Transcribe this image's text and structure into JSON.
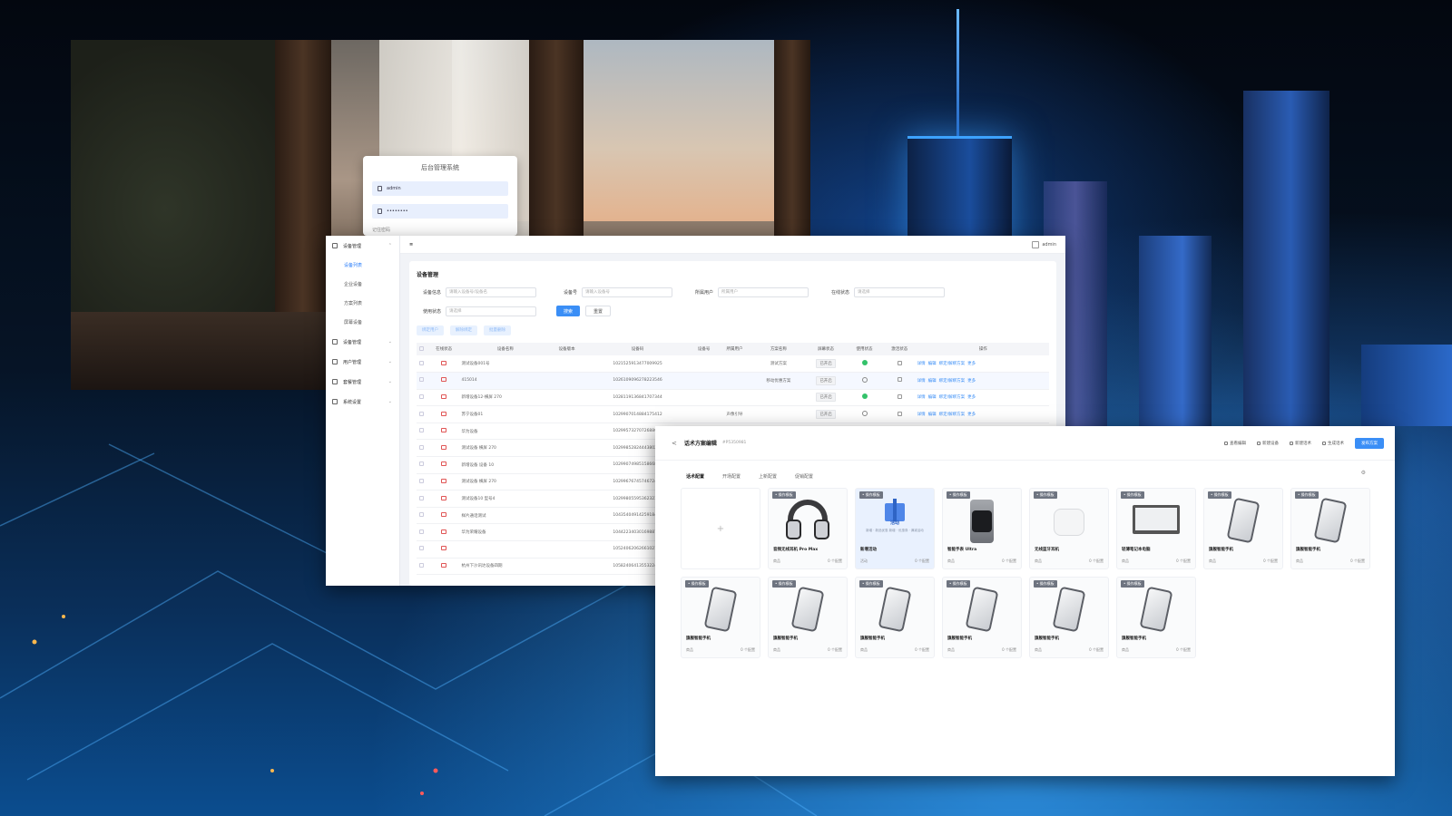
{
  "login": {
    "title": "后台管理系统",
    "username": "admin",
    "password": "••••••••",
    "extra": "记住密码"
  },
  "admin": {
    "sidebar": {
      "groups": [
        {
          "label": "设备管理",
          "items": [
            "设备列表",
            "企业设备",
            "方案列表",
            "屏幕设备"
          ]
        },
        {
          "label": "设备管理"
        },
        {
          "label": "用户管理"
        },
        {
          "label": "套餐管理"
        },
        {
          "label": "系统设置"
        }
      ]
    },
    "topbar": {
      "user": "admin"
    },
    "page_title": "设备管理",
    "filters": [
      {
        "label": "设备信息",
        "placeholder": "请输入设备号/设备名"
      },
      {
        "label": "设备号",
        "placeholder": "请输入设备号"
      },
      {
        "label": "所属用户",
        "placeholder": "所属用户"
      },
      {
        "label": "在线状态",
        "placeholder": "请选择"
      },
      {
        "label": "使用状态",
        "placeholder": "请选择"
      }
    ],
    "buttons": {
      "search": "搜索",
      "reset": "重置",
      "bind": "绑定用户",
      "unbind": "解除绑定",
      "batch": "批量删除"
    },
    "columns": [
      "在线状态",
      "设备名称",
      "设备版本",
      "设备码",
      "设备号",
      "所属用户",
      "方案名称",
      "屏幕状态",
      "使用状态",
      "激活状态",
      "操作"
    ],
    "rows": [
      {
        "name": "测试设备001号",
        "code": "1021525913477009925",
        "user": "",
        "scheme": "测试方案",
        "screen": "已开启",
        "status": "ok"
      },
      {
        "name": "415014",
        "code": "1026109096278223546",
        "user": "",
        "scheme": "移动优惠方案",
        "screen": "已开启",
        "status": "ring"
      },
      {
        "name": "新增设备12-横屏 270",
        "code": "1028119136841707344",
        "user": "",
        "scheme": "",
        "screen": "已开启",
        "status": "ok"
      },
      {
        "name": "苏宁设备01",
        "code": "1029907014884175412",
        "user": "声像引导",
        "scheme": "",
        "screen": "已开启",
        "status": "ring"
      },
      {
        "name": "华为设备",
        "code": "1029957327072688080",
        "user": "",
        "scheme": "",
        "screen": "",
        "status": ""
      },
      {
        "name": "测试设备 横屏 270",
        "code": "1029985282444380288",
        "user": "",
        "scheme": "",
        "screen": "",
        "status": ""
      },
      {
        "name": "新增设备 设备 10",
        "code": "1029907498515866846",
        "user": "",
        "scheme": "",
        "screen": "",
        "status": ""
      },
      {
        "name": "测试设备 横屏 270",
        "code": "1029967674574672416",
        "user": "",
        "scheme": "",
        "screen": "",
        "status": ""
      },
      {
        "name": "测试设备10 型号4",
        "code": "1029980559536232364",
        "user": "",
        "scheme": "",
        "screen": "",
        "status": ""
      },
      {
        "name": "样片通话测试",
        "code": "1043540491425918476",
        "user": "",
        "scheme": "",
        "screen": "",
        "status": ""
      },
      {
        "name": "华为荣耀设备",
        "code": "1044223403016988728",
        "user": "",
        "scheme": "",
        "screen": "",
        "status": ""
      },
      {
        "name": "",
        "code": "1052406206266102144",
        "user": "",
        "scheme": "",
        "screen": "",
        "status": ""
      },
      {
        "name": "杭州下沙讯达设备四期",
        "code": "1058240641355322498",
        "user": "",
        "scheme": "",
        "screen": "",
        "status": ""
      }
    ],
    "row_ops": [
      "详情",
      "编辑",
      "绑定/解绑方案",
      "更多"
    ]
  },
  "editor": {
    "back": "<",
    "title": "话术方案编辑",
    "scheme_id": "#P5350981",
    "actions": [
      "查看编辑",
      "新建设备",
      "新建话术",
      "生成话术",
      "发布方案"
    ],
    "tabs": [
      "话术配置",
      "开场配置",
      "上新配置",
      "促销配置"
    ],
    "cards": [
      {
        "kind": "add"
      },
      {
        "kind": "headphone",
        "badge": "• 操作模板",
        "name": "音频无线耳机 Pro Max",
        "left": "商品",
        "right": "0 个配置"
      },
      {
        "kind": "gift",
        "badge": "• 操作模板",
        "name": "新增活动",
        "left": "活动",
        "right": "0 个配置",
        "gift_title": "活动",
        "gift_sub": "新增 · 新品优惠 新增 · 优惠券 · 满减活动"
      },
      {
        "kind": "watch",
        "badge": "• 操作模板",
        "name": "智能手表 Ultra",
        "left": "商品",
        "right": "0 个配置"
      },
      {
        "kind": "pods",
        "badge": "• 操作模板",
        "name": "无线蓝牙耳机",
        "left": "商品",
        "right": "0 个配置"
      },
      {
        "kind": "laptop",
        "badge": "• 操作模板",
        "name": "轻薄笔记本电脑",
        "left": "商品",
        "right": "0 个配置"
      },
      {
        "kind": "phone",
        "badge": "• 操作模板",
        "name": "旗舰智能手机",
        "left": "商品",
        "right": "0 个配置"
      },
      {
        "kind": "phone",
        "badge": "• 操作模板",
        "name": "旗舰智能手机",
        "left": "商品",
        "right": "0 个配置"
      },
      {
        "kind": "phone",
        "badge": "• 操作模板",
        "name": "旗舰智能手机",
        "left": "商品",
        "right": "0 个配置"
      },
      {
        "kind": "phone",
        "badge": "• 操作模板",
        "name": "旗舰智能手机",
        "left": "商品",
        "right": "0 个配置"
      },
      {
        "kind": "phone",
        "badge": "• 操作模板",
        "name": "旗舰智能手机",
        "left": "商品",
        "right": "0 个配置"
      },
      {
        "kind": "phone",
        "badge": "• 操作模板",
        "name": "旗舰智能手机",
        "left": "商品",
        "right": "0 个配置"
      },
      {
        "kind": "phone",
        "badge": "• 操作模板",
        "name": "旗舰智能手机",
        "left": "商品",
        "right": "0 个配置"
      },
      {
        "kind": "phone",
        "badge": "• 操作模板",
        "name": "旗舰智能手机",
        "left": "商品",
        "right": "0 个配置"
      }
    ]
  },
  "colors": {
    "accent": "#3a8ef6",
    "success": "#33c26a",
    "danger": "#e05555"
  }
}
